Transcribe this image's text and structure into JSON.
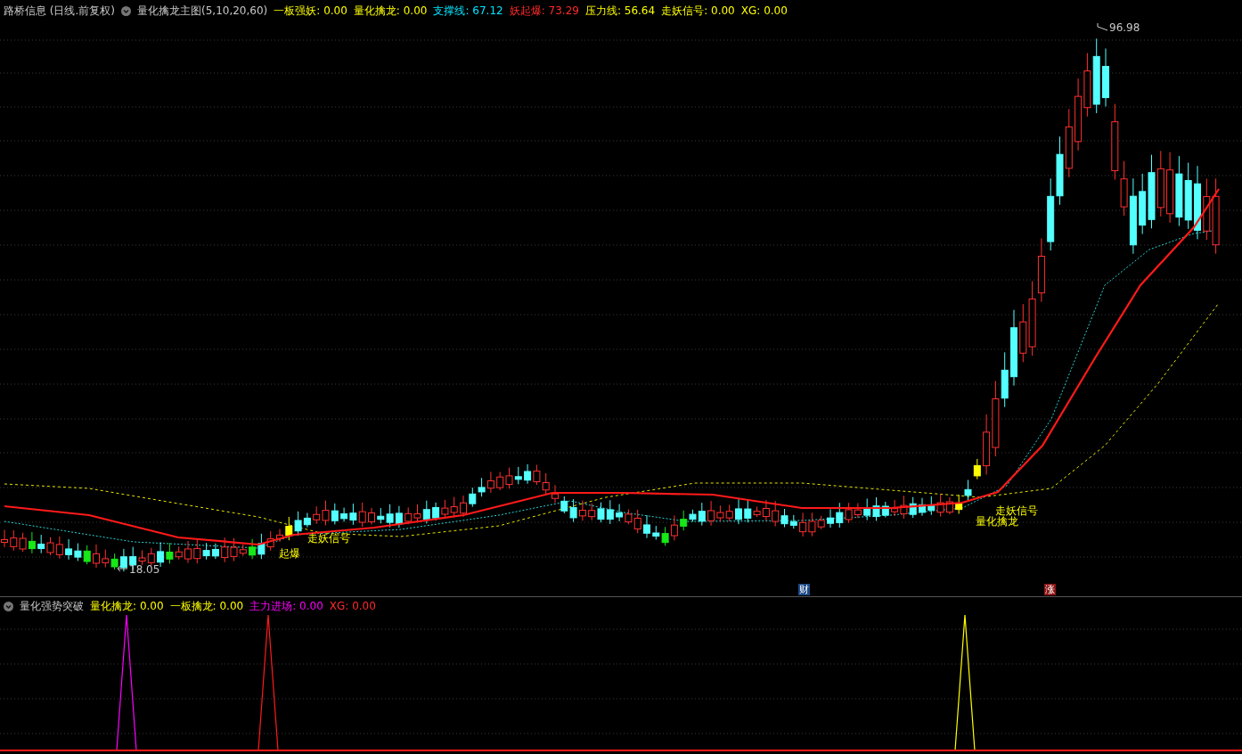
{
  "main_header": {
    "title": "路桥信息 (日线.前复权)",
    "indicator": "量化擒龙主图(5,10,20,60)",
    "readings": [
      {
        "label": "一板强妖:",
        "value": "0.00",
        "color": "#ffff00"
      },
      {
        "label": "量化擒龙:",
        "value": "0.00",
        "color": "#ffff00"
      },
      {
        "label": "支撑线:",
        "value": "67.12",
        "color": "#00e5ff"
      },
      {
        "label": "妖起爆:",
        "value": "73.29",
        "color": "#ff2a2a"
      },
      {
        "label": "压力线:",
        "value": "56.64",
        "color": "#ffff00"
      },
      {
        "label": "走妖信号:",
        "value": "0.00",
        "color": "#ffff00"
      },
      {
        "label": "XG:",
        "value": "0.00",
        "color": "#ffff00"
      }
    ]
  },
  "chart_labels": [
    {
      "text": "96.98",
      "kind": "price"
    },
    {
      "text": "18.05",
      "kind": "price"
    },
    {
      "text": "起爆",
      "kind": "signal"
    },
    {
      "text": "走妖信号",
      "kind": "signal"
    },
    {
      "text": "走妖信号",
      "kind": "signal"
    },
    {
      "text": "量化擒龙",
      "kind": "signal"
    }
  ],
  "markers": [
    {
      "text": "财",
      "color": "#1d4a86"
    },
    {
      "text": "涨",
      "color": "#8c1414"
    }
  ],
  "sub_header": {
    "title": "量化强势突破",
    "readings": [
      {
        "label": "量化擒龙:",
        "value": "0.00",
        "color": "#ffff00"
      },
      {
        "label": "一板擒龙:",
        "value": "0.00",
        "color": "#ffff00"
      },
      {
        "label": "主力进场:",
        "value": "0.00",
        "color": "#ff00ff"
      },
      {
        "label": "XG:",
        "value": "0.00",
        "color": "#ff2a2a"
      }
    ]
  }
}
